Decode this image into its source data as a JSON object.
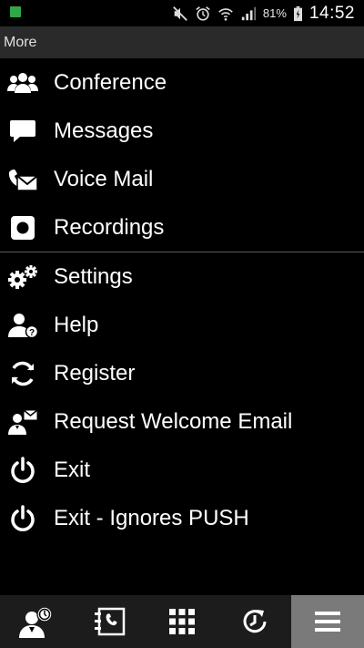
{
  "status_bar": {
    "battery_percent": "81%",
    "time": "14:52",
    "icons": [
      "app-notification-icon",
      "mute-icon",
      "alarm-icon",
      "wifi-icon",
      "signal-icon",
      "battery-charging-icon"
    ]
  },
  "header": {
    "title": "More"
  },
  "menu": {
    "group1": [
      {
        "label": "Conference",
        "icon": "conference-icon"
      },
      {
        "label": "Messages",
        "icon": "messages-icon"
      },
      {
        "label": "Voice Mail",
        "icon": "voicemail-icon"
      },
      {
        "label": "Recordings",
        "icon": "recordings-icon"
      }
    ],
    "group2": [
      {
        "label": "Settings",
        "icon": "gears-icon"
      },
      {
        "label": "Help",
        "icon": "help-icon"
      },
      {
        "label": "Register",
        "icon": "refresh-icon"
      },
      {
        "label": "Request Welcome Email",
        "icon": "welcome-email-icon"
      },
      {
        "label": "Exit",
        "icon": "power-icon"
      },
      {
        "label": "Exit - Ignores PUSH",
        "icon": "power-icon"
      }
    ]
  },
  "bottom_nav": {
    "items": [
      {
        "icon": "presence-icon"
      },
      {
        "icon": "contacts-icon"
      },
      {
        "icon": "dialpad-icon"
      },
      {
        "icon": "history-icon"
      },
      {
        "icon": "menu-icon",
        "active": true
      }
    ]
  },
  "colors": {
    "background": "#000000",
    "header_bg": "#2a2a2a",
    "bottom_bar_bg": "#1c1c1c",
    "active_tab_bg": "#7a7a7a",
    "status_dot": "#2ea84a"
  }
}
